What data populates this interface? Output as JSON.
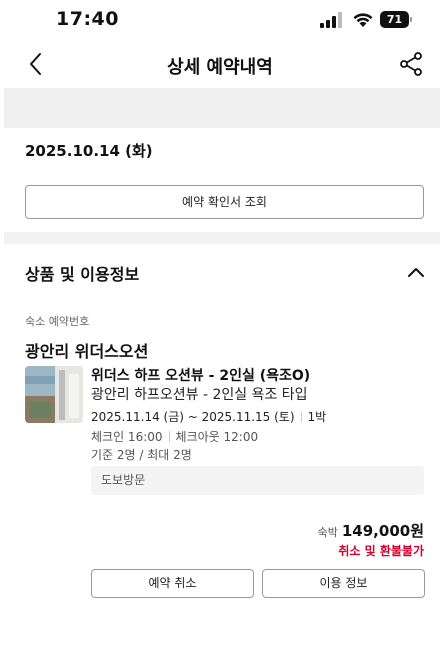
{
  "status_bar": {
    "time": "17:40",
    "battery": "71"
  },
  "nav": {
    "title": "상세 예약내역"
  },
  "reservation": {
    "date": "2025.10.14 (화)",
    "confirm_button": "예약 확인서 조회"
  },
  "section": {
    "title": "상품 및 이용정보"
  },
  "booking": {
    "number_label": "숙소 예약번호",
    "hotel_name": "광안리 위더스오션",
    "room_name": "위더스 하프 오션뷰 - 2인실 (욕조O)",
    "room_type": "광안리 하프오션뷰 - 2인실 욕조 타입",
    "stay_dates": "2025.11.14 (금) ~ 2025.11.15 (토)",
    "nights": "1박",
    "check_in": "체크인 16:00",
    "check_out": "체크아웃 12:00",
    "occupancy": "기준 2명 / 최대 2명",
    "visit_type": "도보방문"
  },
  "price": {
    "label": "숙박",
    "value": "149,000원",
    "refund_note": "취소 및 환불불가"
  },
  "actions": {
    "cancel_label": "예약 취소",
    "info_label": "이용 정보"
  },
  "colors": {
    "accent_red": "#d3002e",
    "band_gray": "#f0f0f0"
  },
  "icons": {
    "back": "chevron-left-icon",
    "share": "share-icon",
    "collapse": "chevron-up-icon"
  }
}
